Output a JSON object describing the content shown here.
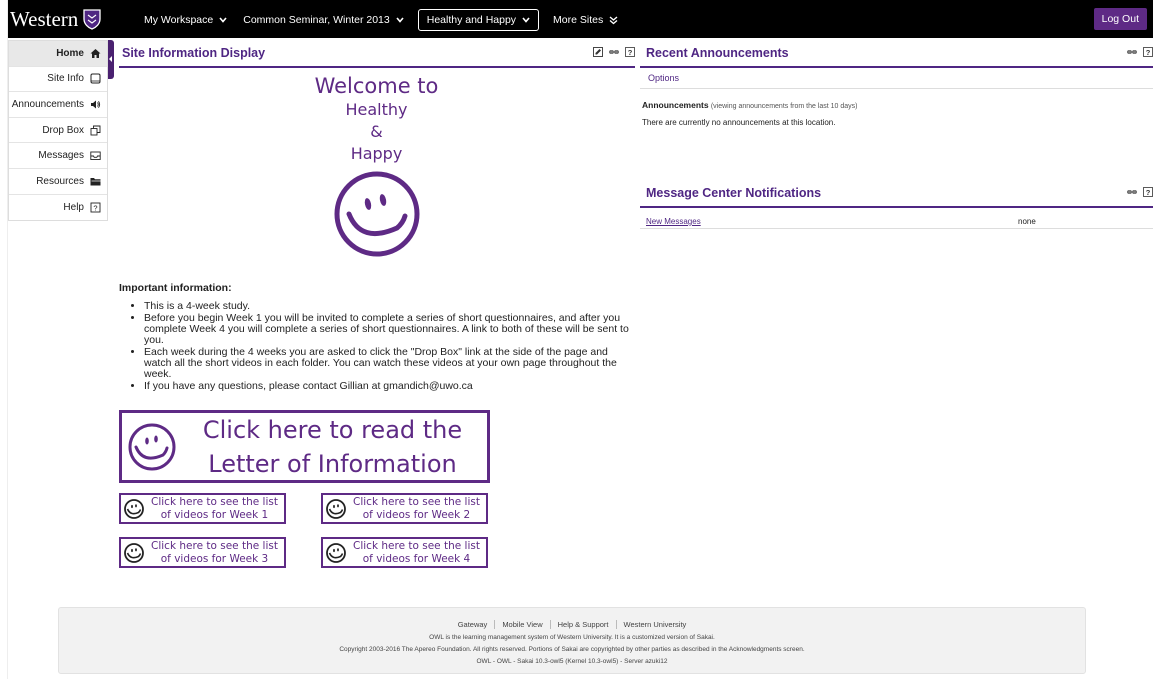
{
  "header": {
    "logo_text": "Western",
    "nav": [
      {
        "label": "My Workspace"
      },
      {
        "label": "Common Seminar, Winter 2013"
      },
      {
        "label": "Healthy and Happy"
      },
      {
        "label": "More Sites"
      }
    ],
    "logout_label": "Log Out"
  },
  "sidebar": {
    "items": [
      {
        "label": "Home",
        "icon": "home-icon"
      },
      {
        "label": "Site Info",
        "icon": "tablet-icon"
      },
      {
        "label": "Announcements",
        "icon": "speaker-icon"
      },
      {
        "label": "Drop Box",
        "icon": "copy-icon"
      },
      {
        "label": "Messages",
        "icon": "inbox-icon"
      },
      {
        "label": "Resources",
        "icon": "folder-icon"
      },
      {
        "label": "Help",
        "icon": "help-icon"
      }
    ]
  },
  "site_info": {
    "title": "Site Information Display",
    "welcome": [
      "Welcome to",
      "Healthy",
      "&",
      "Happy"
    ],
    "important_heading": "Important information:",
    "bullets": [
      "This is a 4-week study.",
      "Before you begin Week 1 you will be invited to complete a series of short questionnaires, and after you complete Week 4 you will complete a series of short questionnaires. A link to both of these will be sent to you.",
      "Each week during the 4 weeks you are asked to click the \"Drop Box\" link at the side of the page and watch all the short videos in each folder. You can watch these videos at your own page throughout the week.",
      "If you have any questions, please contact Gillian at gmandich@uwo.ca"
    ],
    "letter_button": {
      "line1": "Click here to read the",
      "line2": "Letter of Information"
    },
    "week_buttons": [
      {
        "line1": "Click here to see the list",
        "line2": "of videos for Week 1"
      },
      {
        "line1": "Click here to see the list",
        "line2": "of videos for Week 2"
      },
      {
        "line1": "Click here to see the list",
        "line2": "of videos for Week 3"
      },
      {
        "line1": "Click here to see the list",
        "line2": "of videos for Week 4"
      }
    ]
  },
  "announcements": {
    "title": "Recent Announcements",
    "options_label": "Options",
    "heading": "Announcements",
    "heading_note": "(viewing announcements from the last 10 days)",
    "empty_text": "There are currently no announcements at this location."
  },
  "messages": {
    "title": "Message Center Notifications",
    "row_label": "New Messages",
    "row_value": "none"
  },
  "footer": {
    "links": [
      "Gateway",
      "Mobile View",
      "Help & Support",
      "Western University"
    ],
    "line1": "OWL is the learning management system of Western University. It is a customized version of Sakai.",
    "line2": "Copyright 2003-2016 The Apereo Foundation. All rights reserved. Portions of Sakai are copyrighted by other parties as described in the Acknowledgments screen.",
    "line3": "OWL - OWL - Sakai 10.3-owl5 (Kernel 10.3-owl5) - Server azuki12"
  },
  "colors": {
    "brand": "#4f2683",
    "accent": "#5e2a85"
  }
}
